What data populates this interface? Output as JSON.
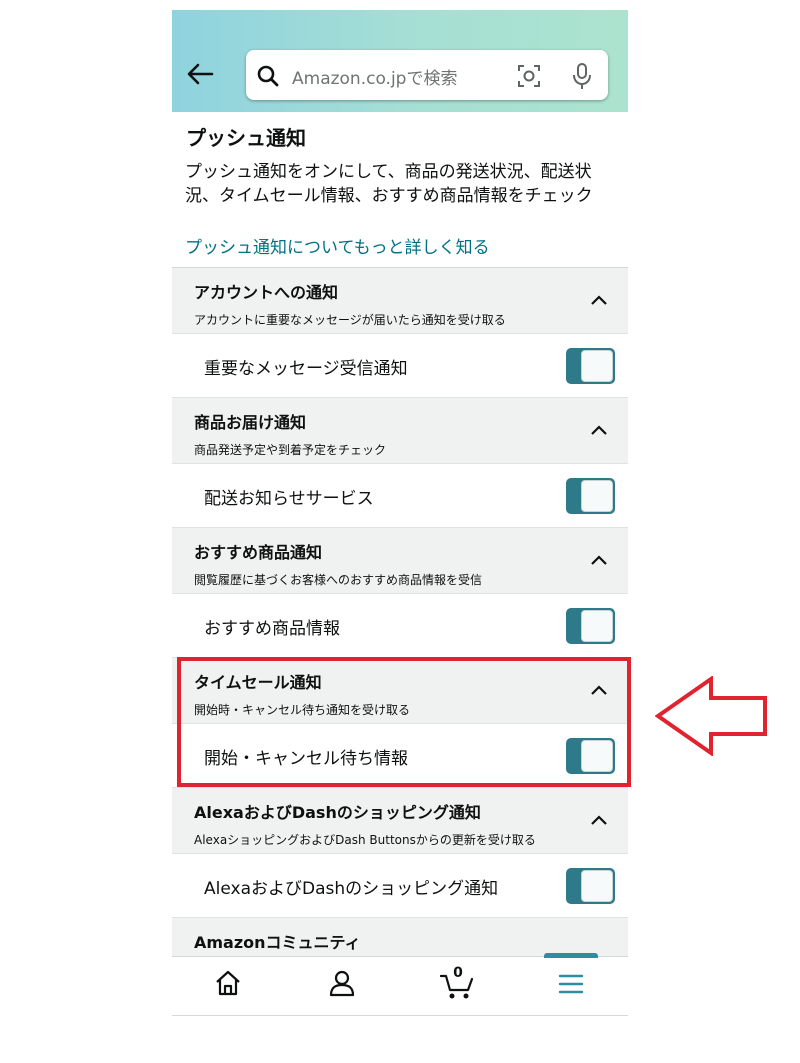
{
  "search": {
    "placeholder": "Amazon.co.jpで検索"
  },
  "page": {
    "title": "プッシュ通知",
    "description": "プッシュ通知をオンにして、商品の発送状況、配送状況、タイムセール情報、おすすめ商品情報をチェック",
    "learn_more": "プッシュ通知についてもっと詳しく知る"
  },
  "sections": [
    {
      "title": "アカウントへの通知",
      "subtitle": "アカウントに重要なメッセージが届いたら通知を受け取る",
      "item": "重要なメッセージ受信通知",
      "enabled": true
    },
    {
      "title": "商品お届け通知",
      "subtitle": "商品発送予定や到着予定をチェック",
      "item": "配送お知らせサービス",
      "enabled": true
    },
    {
      "title": "おすすめ商品通知",
      "subtitle": "閲覧履歴に基づくお客様へのおすすめ商品情報を受信",
      "item": "おすすめ商品情報",
      "enabled": true
    },
    {
      "title": "タイムセール通知",
      "subtitle": "開始時・キャンセル待ち通知を受け取る",
      "item": "開始・キャンセル待ち情報",
      "enabled": true
    },
    {
      "title": "AlexaおよびDashのショッピング通知",
      "subtitle": "AlexaショッピングおよびDash Buttonsからの更新を受け取る",
      "item": "AlexaおよびDashのショッピング通知",
      "enabled": true
    },
    {
      "title": "Amazonコミュニティ"
    }
  ],
  "tabbar": {
    "cart_count": "0",
    "active": "menu"
  },
  "colors": {
    "accent": "#2e7a89",
    "link": "#007185",
    "highlight": "#e0242f"
  }
}
